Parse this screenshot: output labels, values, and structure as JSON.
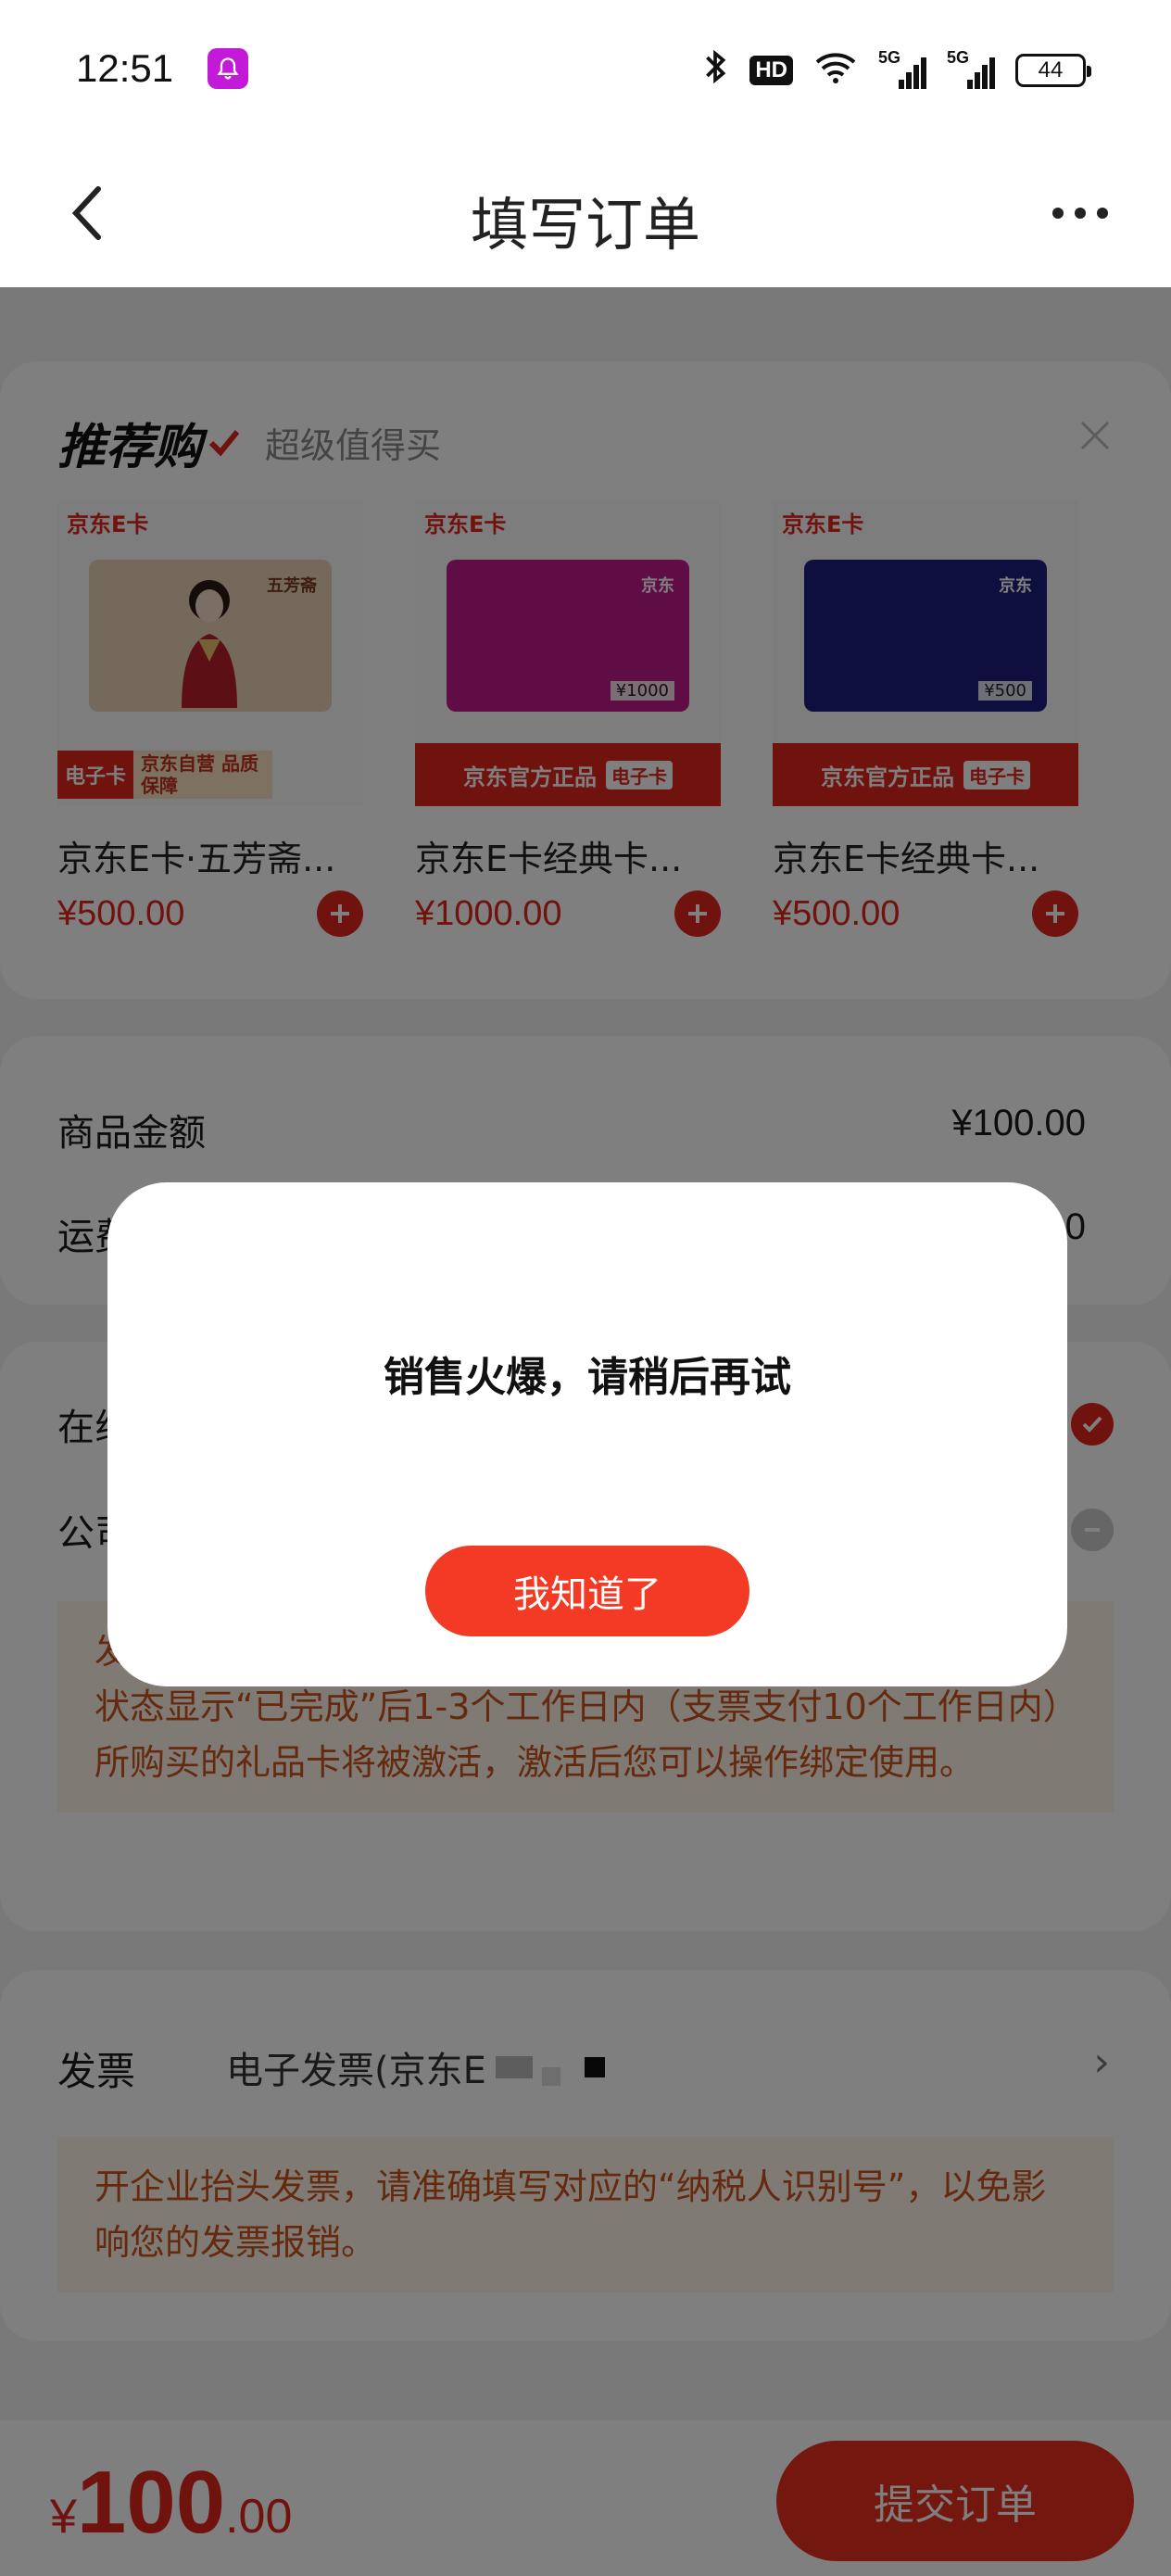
{
  "status_bar": {
    "time": "12:51",
    "hd": "HD",
    "net1": "5G",
    "net2": "5G",
    "battery": "44"
  },
  "nav": {
    "title": "填写订单"
  },
  "recommend": {
    "title": "推荐购",
    "subtitle": "超级值得买",
    "products": [
      {
        "tag": "京东E卡",
        "name": "京东E卡·五芳斋...",
        "price": "¥500.00",
        "band_left": "电子卡",
        "band_right": "京东自营 品质保障",
        "card_color": "#e9d3b7",
        "card_brand": "五芳斋",
        "card_value": ""
      },
      {
        "tag": "京东E卡",
        "name": "京东E卡经典卡...",
        "price": "¥1000.00",
        "band_left": "京东官方正品",
        "band_right": "电子卡",
        "card_color": "#c21b8a",
        "card_brand": "京东",
        "card_value": "¥1000"
      },
      {
        "tag": "京东E卡",
        "name": "京东E卡经典卡...",
        "price": "¥500.00",
        "band_left": "京东官方正品",
        "band_right": "电子卡",
        "card_color": "#1e1e7e",
        "card_brand": "京东",
        "card_value": "¥500"
      }
    ]
  },
  "amount": {
    "goods_label": "商品金额",
    "goods_value": "¥100.00",
    "shipping_label": "运费",
    "shipping_value": "¥0.00"
  },
  "payment": {
    "online_label": "在线支付",
    "corp_label": "公司转账",
    "notice": "发货：电子卡为虚拟商品，以支付成功时间开始计算，在订单状态显示“已完成”后1-3个工作日内（支票支付10个工作日内）所购买的礼品卡将被激活，激活后您可以操作绑定使用。"
  },
  "invoice": {
    "label": "发票",
    "value": "电子发票(京东E",
    "tip": "开企业抬头发票，请准确填写对应的“纳税人识别号”，以免影响您的发票报销。"
  },
  "bottom": {
    "currency": "¥",
    "int": "100",
    "dec": ".00",
    "submit": "提交订单"
  },
  "dialog": {
    "message": "销售火爆，请稍后再试",
    "confirm": "我知道了"
  },
  "colors": {
    "accent": "#e1251b",
    "button": "#f23a24"
  }
}
